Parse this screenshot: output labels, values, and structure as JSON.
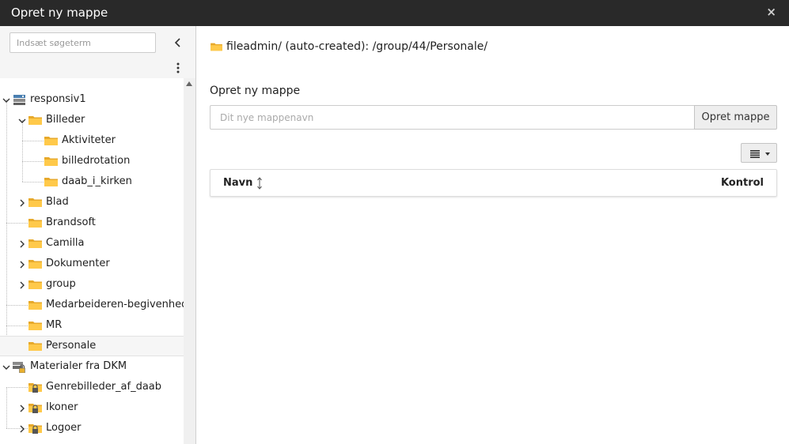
{
  "window": {
    "title": "Opret ny mappe",
    "close_label": "×"
  },
  "sidebar": {
    "search_placeholder": "Indsæt søgeterm",
    "tree": [
      {
        "label": "responsiv1",
        "icon": "storage-icon"
      },
      {
        "label": "Billeder",
        "icon": "folder-icon"
      },
      {
        "label": "Aktiviteter",
        "icon": "folder-icon"
      },
      {
        "label": "billedrotation",
        "icon": "folder-icon"
      },
      {
        "label": "daab_i_kirken",
        "icon": "folder-icon"
      },
      {
        "label": "Blad",
        "icon": "folder-icon"
      },
      {
        "label": "Brandsoft",
        "icon": "folder-icon"
      },
      {
        "label": "Camilla",
        "icon": "folder-icon"
      },
      {
        "label": "Dokumenter",
        "icon": "folder-icon"
      },
      {
        "label": "group",
        "icon": "folder-icon"
      },
      {
        "label": "Medarbeideren-begivenhedsbilleder",
        "icon": "folder-icon"
      },
      {
        "label": "MR",
        "icon": "folder-icon"
      },
      {
        "label": "Personale",
        "icon": "folder-icon",
        "selected": true
      },
      {
        "label": "Materialer fra DKM",
        "icon": "locked-storage-icon"
      },
      {
        "label": "Genrebilleder_af_daab",
        "icon": "locked-folder-icon"
      },
      {
        "label": "Ikoner",
        "icon": "locked-folder-icon"
      },
      {
        "label": "Logoer",
        "icon": "locked-folder-icon"
      }
    ]
  },
  "main": {
    "path": "fileadmin/ (auto-created): /group/44/Personale/",
    "form_label": "Opret ny mappe",
    "input_placeholder": "Dit nye mappenavn",
    "create_button": "Opret mappe",
    "table": {
      "col_name": "Navn",
      "col_control": "Kontrol"
    }
  },
  "colors": {
    "titlebar": "#292929",
    "folder": "#ffc94a",
    "folder_dark": "#e7a92b",
    "sidebar": "#f5f5f5"
  }
}
